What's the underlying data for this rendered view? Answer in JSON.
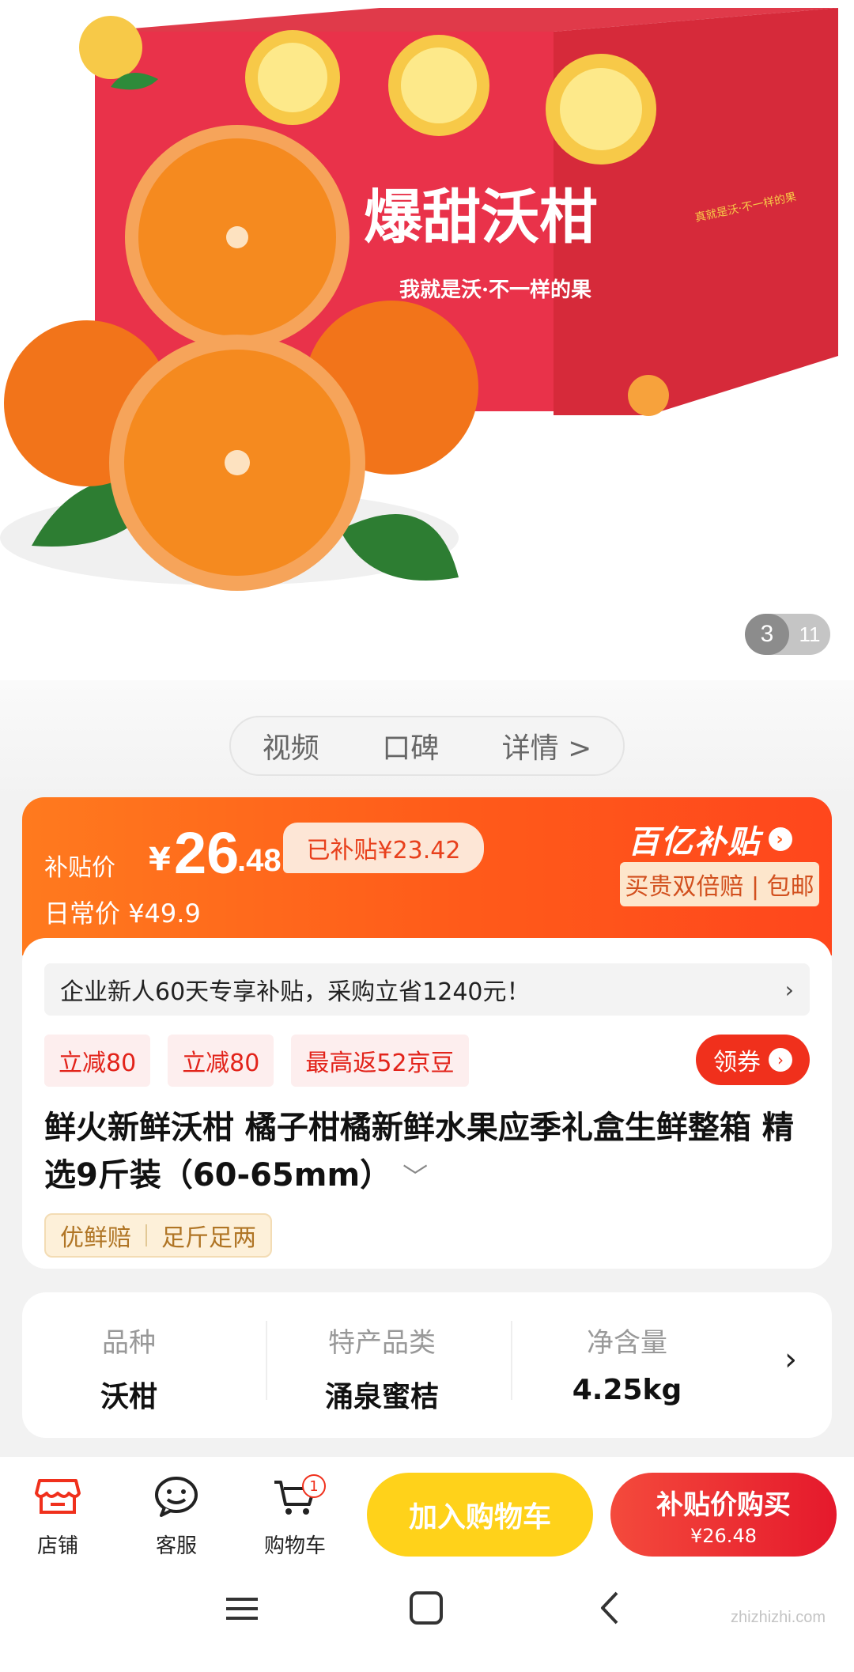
{
  "hero": {
    "box_title": "爆甜沃柑",
    "box_slogan": "我就是沃·不一样的果",
    "box_side_text": "真就是沃·不一样的果",
    "counter_current": "3",
    "counter_total": "11"
  },
  "tabs": [
    "视频",
    "口碑",
    "详情 >"
  ],
  "price": {
    "subsidy_label": "补贴价",
    "currency": "¥",
    "price_int": "26",
    "price_dec": ".48",
    "subsidized_badge": "已补贴¥23.42",
    "daily_label": "日常价",
    "daily_price": "¥49.9",
    "program_logo": "百亿补贴",
    "program_tags": "买贵双倍赔 | 包邮"
  },
  "promo": {
    "text": "企业新人60天专享补贴，采购立省1240元！",
    "chevron": "›"
  },
  "coupons": [
    "立减80",
    "立减80",
    "最高返52京豆"
  ],
  "get_coupon_label": "领券",
  "product": {
    "title": "鲜火新鲜沃柑 橘子柑橘新鲜水果应季礼盒生鲜整箱 精选9斤装（60-65mm）",
    "more": "﹀"
  },
  "tags": [
    "优鲜赔",
    "足斤足两"
  ],
  "specs": [
    {
      "key": "品种",
      "value": "沃柑"
    },
    {
      "key": "特产品类",
      "value": "涌泉蜜桔"
    },
    {
      "key": "净含量",
      "value": "4.25kg"
    }
  ],
  "actions": {
    "store": "店铺",
    "service": "客服",
    "cart": "购物车",
    "cart_count": "1",
    "add_to_cart": "加入购物车",
    "buy_line1": "补贴价购买",
    "buy_line2": "¥26.48"
  },
  "watermark": "zhizhizhi.com",
  "colors": {
    "accent_orange": "#ff5a1a",
    "coupon_red": "#e2231a",
    "add_cart_yellow": "#ffd21a",
    "buy_red": "#e5192c"
  },
  "icons": [
    "store-icon",
    "service-smile-icon",
    "cart-icon",
    "menu-icon",
    "home-icon",
    "back-icon"
  ]
}
